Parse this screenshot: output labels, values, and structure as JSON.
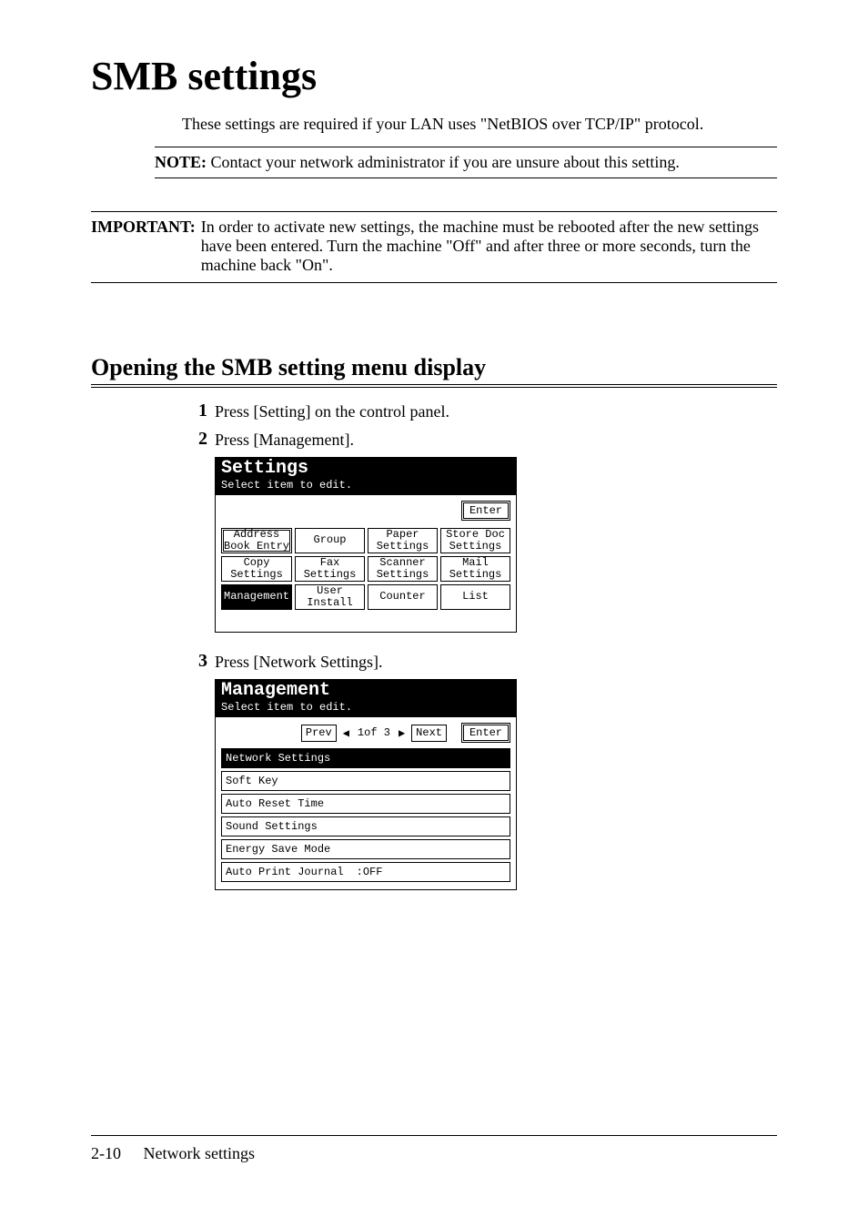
{
  "title": "SMB settings",
  "intro": "These settings are required if your LAN uses \"NetBIOS over TCP/IP\" protocol.",
  "note": {
    "label": "NOTE:",
    "text": "Contact your network administrator if you are unsure about this setting."
  },
  "important": {
    "label": "IMPORTANT:",
    "text": "In order to activate new settings, the machine must be rebooted after the new settings have been entered. Turn the machine \"Off\" and after three or more seconds, turn the machine back \"On\"."
  },
  "section_heading": "Opening the SMB setting menu display",
  "steps": {
    "1": "Press [Setting] on the control panel.",
    "2": "Press [Management].",
    "3": "Press [Network Settings]."
  },
  "screen1": {
    "title": "Settings",
    "subtitle": "Select item to edit.",
    "enter": "Enter",
    "buttons": [
      "Address\nBook Entry",
      "Group",
      "Paper\nSettings",
      "Store Doc\nSettings",
      "Copy\nSettings",
      "Fax\nSettings",
      "Scanner\nSettings",
      "Mail\nSettings",
      "Management",
      "User\nInstall",
      "Counter",
      "List"
    ]
  },
  "screen2": {
    "title": "Management",
    "subtitle": "Select item to edit.",
    "prev": "Prev",
    "page_indicator": "1of  3",
    "next": "Next",
    "enter": "Enter",
    "items": [
      {
        "label": "Network Settings",
        "value": ""
      },
      {
        "label": "Soft Key",
        "value": ""
      },
      {
        "label": "Auto Reset Time",
        "value": ""
      },
      {
        "label": "Sound Settings",
        "value": ""
      },
      {
        "label": "Energy Save Mode",
        "value": ""
      },
      {
        "label": "Auto Print Journal",
        "value": ":OFF"
      }
    ]
  },
  "footer": {
    "page": "2-10",
    "section": "Network settings"
  }
}
